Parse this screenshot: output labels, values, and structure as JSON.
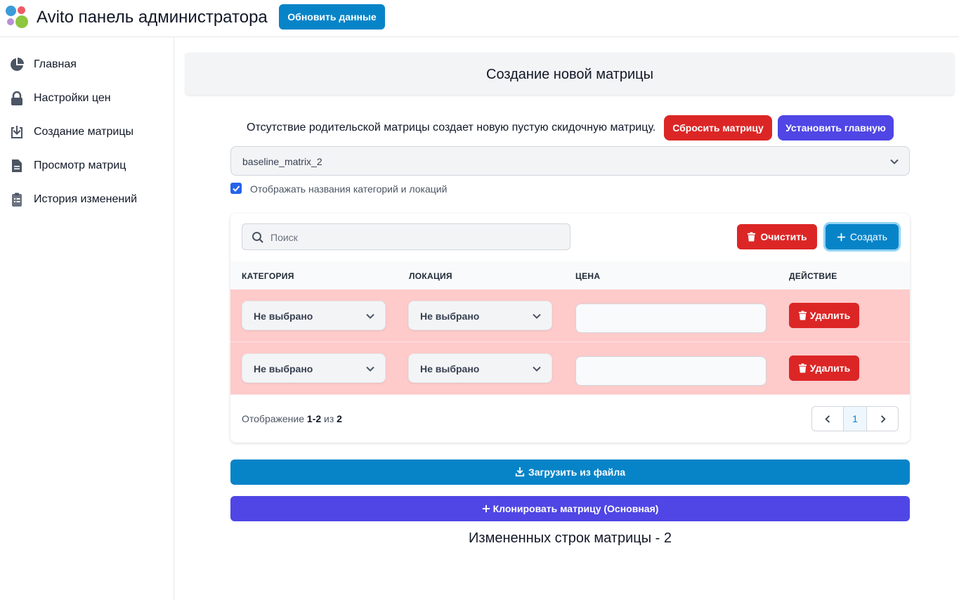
{
  "header": {
    "title": "Avito панель администратора",
    "refresh_label": "Обновить данные",
    "logo_colors": [
      "#3b9bd8",
      "#ef5b67",
      "#b98fd6",
      "#8dc63f"
    ]
  },
  "sidebar": {
    "items": [
      {
        "label": "Главная",
        "icon": "pie-chart-icon"
      },
      {
        "label": "Настройки цен",
        "icon": "lock-icon"
      },
      {
        "label": "Создание матрицы",
        "icon": "download-box-icon"
      },
      {
        "label": "Просмотр матриц",
        "icon": "document-icon"
      },
      {
        "label": "История изменений",
        "icon": "clipboard-icon"
      }
    ]
  },
  "page": {
    "title": "Создание новой матрицы",
    "info_text": "Отсутствие родительской матрицы создает новую пустую скидочную матрицу.",
    "reset_label": "Сбросить матрицу",
    "set_main_label": "Установить главную",
    "matrix_select_value": "baseline_matrix_2",
    "checkbox_label": "Отображать названия категорий и локаций",
    "checkbox_checked": true
  },
  "table": {
    "search_placeholder": "Поиск",
    "clear_label": "Очистить",
    "create_label": "Создать",
    "columns": [
      "КАТЕГОРИЯ",
      "ЛОКАЦИЯ",
      "ЦЕНА",
      "ДЕЙСТВИЕ"
    ],
    "rows": [
      {
        "category": "Не выбрано",
        "location": "Не выбрано",
        "price": "",
        "action": "Удалить"
      },
      {
        "category": "Не выбрано",
        "location": "Не выбрано",
        "price": "",
        "action": "Удалить"
      }
    ],
    "showing_prefix": "Отображение",
    "showing_range": "1-2",
    "showing_of": "из",
    "showing_total": "2",
    "current_page": "1"
  },
  "actions": {
    "upload_label": "Загрузить из файла",
    "clone_label": "Клонировать матрицу (Основная)",
    "changed_rows_text": "Измененных строк матрицы - 2"
  },
  "colors": {
    "primary": "#0784c8",
    "danger": "#dc2626",
    "indigo": "#4f46e5",
    "row_highlight": "#fecaca"
  }
}
